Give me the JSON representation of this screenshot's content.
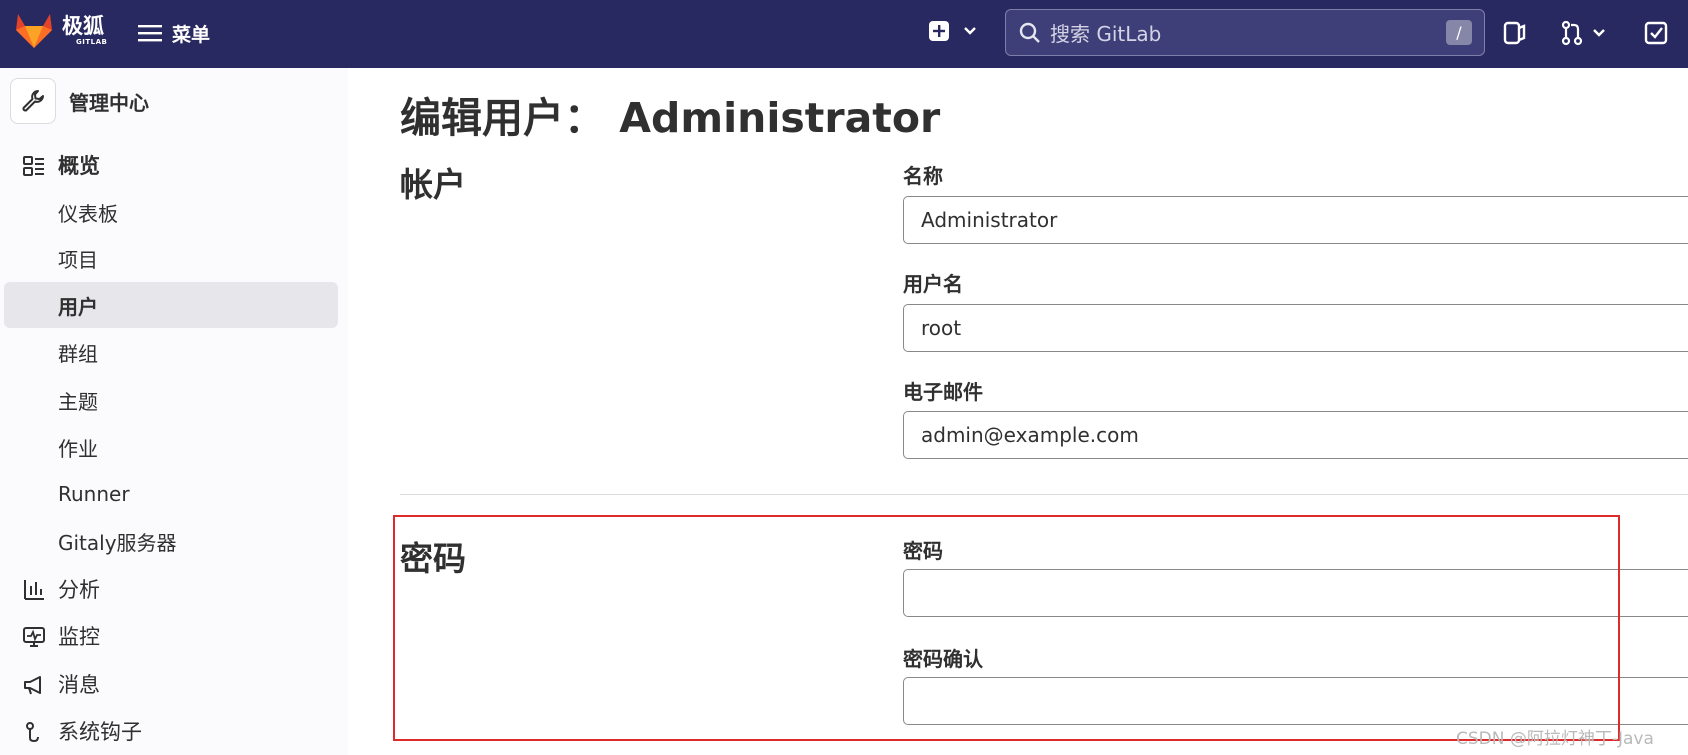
{
  "header": {
    "logo_text": "极狐",
    "logo_subtext": "GITLAB",
    "menu_label": "菜单",
    "search_placeholder": "搜索 GitLab",
    "search_shortcut": "/"
  },
  "sidebar": {
    "context_label": "管理中心",
    "items": [
      {
        "label": "概览",
        "icon": "overview-icon"
      },
      {
        "label": "仪表板"
      },
      {
        "label": "项目"
      },
      {
        "label": "用户",
        "active": true
      },
      {
        "label": "群组"
      },
      {
        "label": "主题"
      },
      {
        "label": "作业"
      },
      {
        "label": "Runner"
      },
      {
        "label": "Gitaly服务器"
      },
      {
        "label": "分析",
        "icon": "chart-icon"
      },
      {
        "label": "监控",
        "icon": "monitor-icon"
      },
      {
        "label": "消息",
        "icon": "megaphone-icon"
      },
      {
        "label": "系统钩子",
        "icon": "hook-icon"
      }
    ]
  },
  "main": {
    "title": "编辑用户：  Administrator",
    "account": {
      "section_title": "帐户",
      "name_label": "名称",
      "name_value": "Administrator",
      "username_label": "用户名",
      "username_value": "root",
      "email_label": "电子邮件",
      "email_value": "admin@example.com"
    },
    "password": {
      "section_title": "密码",
      "password_label": "密码",
      "password_value": "",
      "confirm_label": "密码确认",
      "confirm_value": ""
    }
  },
  "watermark": "CSDN @阿拉灯神丁-Java",
  "colors": {
    "topbar": "#292961",
    "highlight_border": "#dd2b2b",
    "sidebar_bg": "#fbfafd",
    "active_item_bg": "#e7e6ea"
  }
}
